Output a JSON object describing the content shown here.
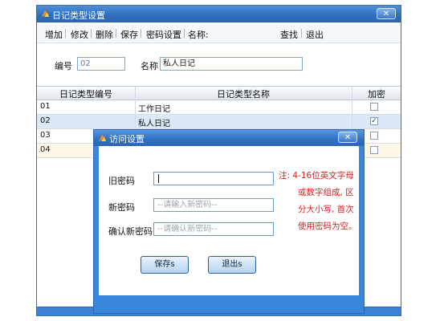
{
  "main_window": {
    "title": "日记类型设置",
    "close_glyph": "✕",
    "toolbar": {
      "add": "增加",
      "edit": "修改",
      "delete": "删除",
      "save": "保存",
      "password_settings": "密码设置",
      "name_label": "名称:",
      "search": "查找",
      "exit": "退出"
    },
    "form": {
      "id_label": "编号",
      "id_value": "02",
      "name_label": "名称",
      "name_value": "私人日记"
    },
    "grid": {
      "headers": [
        "日记类型编号",
        "日记类型名称",
        "加密"
      ],
      "rows": [
        {
          "id": "01",
          "name": "工作日记",
          "encrypted": false
        },
        {
          "id": "02",
          "name": "私人日记",
          "encrypted": true
        },
        {
          "id": "03",
          "name": "",
          "encrypted": false
        },
        {
          "id": "04",
          "name": "",
          "encrypted": false
        }
      ],
      "check_glyph": "✓"
    }
  },
  "dialog": {
    "title": "访问设置",
    "close_glyph": "✕",
    "old_password_label": "旧密码",
    "old_password_value": "",
    "new_password_label": "新密码",
    "new_password_placeholder": "--请输入新密码--",
    "confirm_password_label": "确认新密码",
    "confirm_password_placeholder": "--请确认新密码--",
    "note_lines": [
      "注: 4-16位英文字母",
      "或数字组成, 区",
      "分大小写, 首次",
      "使用密码为空。"
    ],
    "save_button": "保存s",
    "exit_button": "退出s"
  },
  "colors": {
    "titlebar": "#2f6fc0",
    "note": "#d42020",
    "selected_row": "#dbe8f7"
  },
  "icons": {
    "window_icon": "app-icon",
    "close": "close-icon",
    "checkbox": "checkbox-icon"
  }
}
